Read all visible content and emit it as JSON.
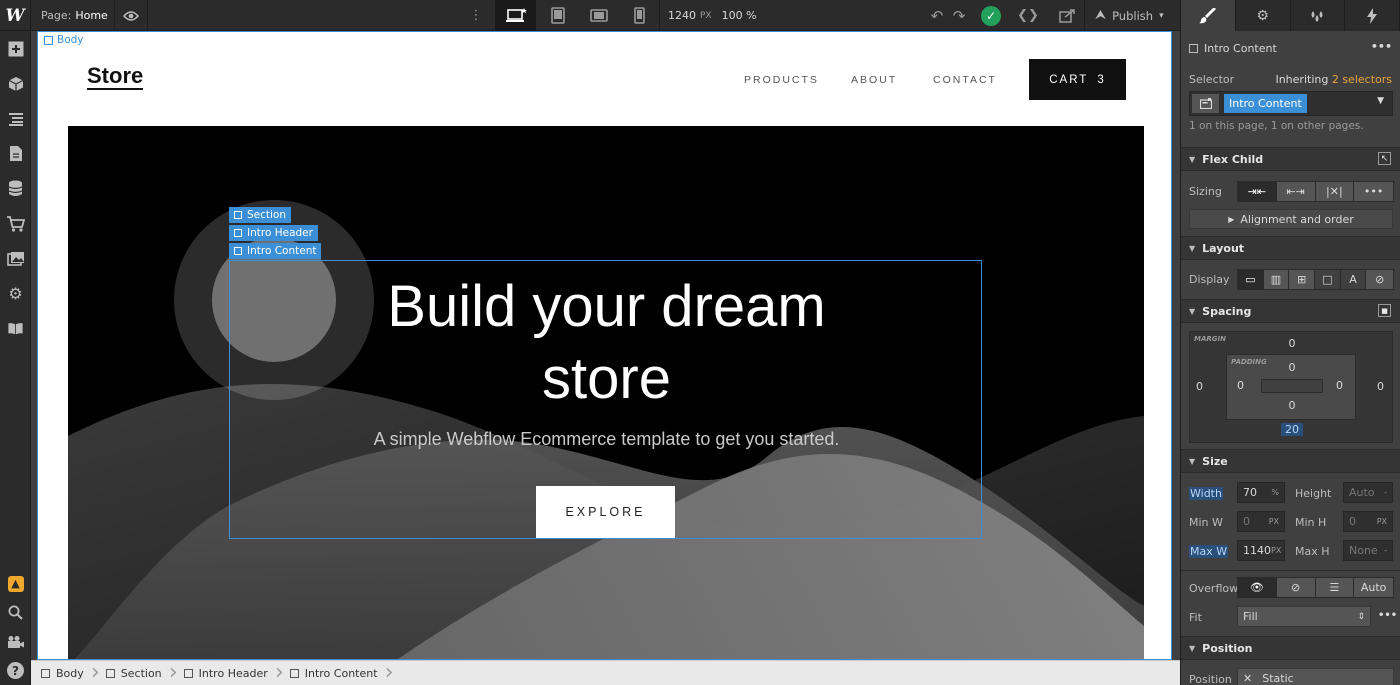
{
  "topbar": {
    "logo": "W",
    "page_label": "Page:",
    "page_name": "Home",
    "canvas_width": "1240",
    "canvas_unit": "PX",
    "zoom": "100 %",
    "publish_label": "Publish"
  },
  "canvas": {
    "body_label": "Body",
    "brand": "Store",
    "nav": [
      "PRODUCTS",
      "ABOUT",
      "CONTACT"
    ],
    "cart_label": "CART",
    "cart_count": "3",
    "selection_tags": [
      "Section",
      "Intro Header",
      "Intro Content"
    ],
    "heading_line1": "Build your dream",
    "heading_line2": "store",
    "subheading": "A simple Webflow Ecommerce template to get you started.",
    "cta": "EXPLORE"
  },
  "breadcrumbs": [
    "Body",
    "Section",
    "Intro Header",
    "Intro Content"
  ],
  "panel": {
    "element_name": "Intro Content",
    "selector_label": "Selector",
    "inheriting_label": "Inheriting",
    "inheriting_count": "2 selectors",
    "selector_chip": "Intro Content",
    "usage_text": "1 on this page, 1 on other pages.",
    "flex_child_title": "Flex Child",
    "sizing_label": "Sizing",
    "alignment_label": "Alignment and order",
    "layout_title": "Layout",
    "display_label": "Display",
    "spacing_title": "Spacing",
    "margin_label": "MARGIN",
    "padding_label": "PADDING",
    "margin": {
      "top": "0",
      "right": "0",
      "bottom": "20",
      "left": "0"
    },
    "padding": {
      "top": "0",
      "right": "0",
      "bottom": "0",
      "left": "0"
    },
    "size_title": "Size",
    "width_label": "Width",
    "width_value": "70",
    "width_unit": "%",
    "height_label": "Height",
    "height_value": "Auto",
    "minw_label": "Min W",
    "minw_value": "0",
    "minh_label": "Min H",
    "minh_value": "0",
    "maxw_label": "Max W",
    "maxw_value": "1140",
    "maxh_label": "Max H",
    "maxh_value": "None",
    "px_unit": "PX",
    "dash": "-",
    "overflow_label": "Overflow",
    "overflow_auto": "Auto",
    "fit_label": "Fit",
    "fit_value": "Fill",
    "position_title": "Position",
    "position_label": "Position",
    "position_value": "Static"
  },
  "colors": {
    "accent": "#3b8fd6",
    "success": "#23a05b",
    "warning": "#f0a82c",
    "orange_link": "#e8a33c"
  }
}
